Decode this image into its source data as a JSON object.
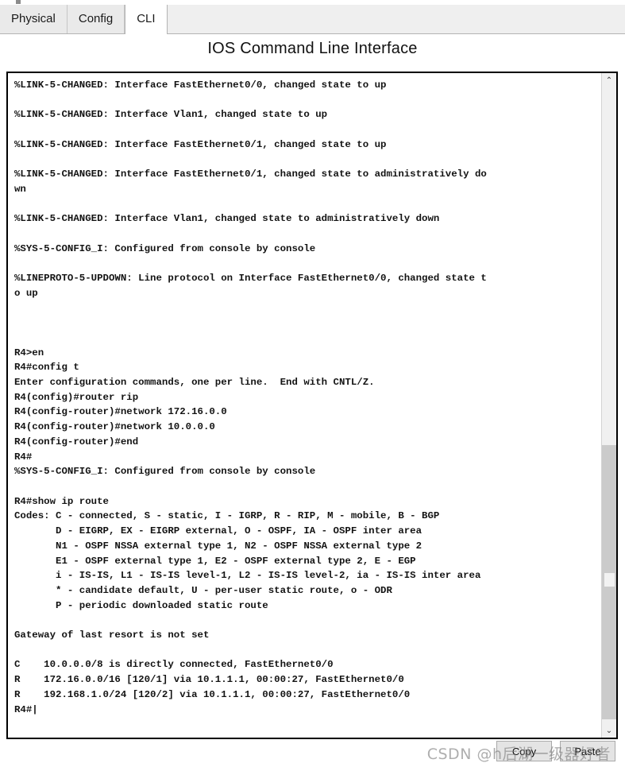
{
  "window": {
    "tabs": [
      {
        "label": "Physical",
        "active": false
      },
      {
        "label": "Config",
        "active": false
      },
      {
        "label": "CLI",
        "active": true
      }
    ],
    "panel_title": "IOS Command Line Interface"
  },
  "terminal": {
    "font_color": "#131313",
    "background": "#ffffff",
    "content": "%LINK-5-CHANGED: Interface FastEthernet0/0, changed state to up\n\n%LINK-5-CHANGED: Interface Vlan1, changed state to up\n\n%LINK-5-CHANGED: Interface FastEthernet0/1, changed state to up\n\n%LINK-5-CHANGED: Interface FastEthernet0/1, changed state to administratively do\nwn\n\n%LINK-5-CHANGED: Interface Vlan1, changed state to administratively down\n\n%SYS-5-CONFIG_I: Configured from console by console\n\n%LINEPROTO-5-UPDOWN: Line protocol on Interface FastEthernet0/0, changed state t\no up\n\n\n\nR4>en\nR4#config t\nEnter configuration commands, one per line.  End with CNTL/Z.\nR4(config)#router rip\nR4(config-router)#network 172.16.0.0\nR4(config-router)#network 10.0.0.0\nR4(config-router)#end\nR4#\n%SYS-5-CONFIG_I: Configured from console by console\n\nR4#show ip route\nCodes: C - connected, S - static, I - IGRP, R - RIP, M - mobile, B - BGP\n       D - EIGRP, EX - EIGRP external, O - OSPF, IA - OSPF inter area\n       N1 - OSPF NSSA external type 1, N2 - OSPF NSSA external type 2\n       E1 - OSPF external type 1, E2 - OSPF external type 2, E - EGP\n       i - IS-IS, L1 - IS-IS level-1, L2 - IS-IS level-2, ia - IS-IS inter area\n       * - candidate default, U - per-user static route, o - ODR\n       P - periodic downloaded static route\n\nGateway of last resort is not set\n\nC    10.0.0.0/8 is directly connected, FastEthernet0/0\nR    172.16.0.0/16 [120/1] via 10.1.1.1, 00:00:27, FastEthernet0/0\nR    192.168.1.0/24 [120/2] via 10.1.1.1, 00:00:27, FastEthernet0/0\nR4#|"
  },
  "scrollbar": {
    "up_arrow": "⌃",
    "down_arrow": "⌄"
  },
  "buttons": {
    "copy": "Copy",
    "paste": "Paste"
  },
  "watermark": {
    "text": "CSDN @h后湖一级器好者"
  }
}
